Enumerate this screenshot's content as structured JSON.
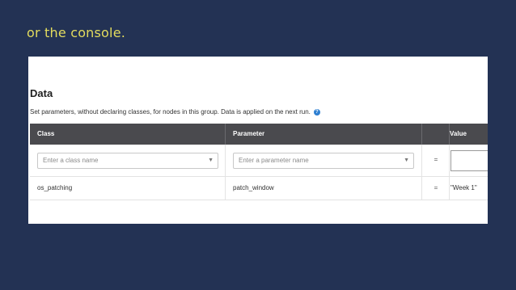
{
  "caption": "or the console.",
  "section": {
    "title": "Data",
    "description": "Set parameters, without declaring classes, for nodes in this group. Data is applied on the next run.",
    "help_icon": "?"
  },
  "table": {
    "headers": {
      "class": "Class",
      "parameter": "Parameter",
      "operator": "",
      "value": "Value"
    },
    "new_row": {
      "class_placeholder": "Enter a class name",
      "parameter_placeholder": "Enter a parameter name",
      "operator": "=",
      "value": ""
    },
    "rows": [
      {
        "class": "os_patching",
        "parameter": "patch_window",
        "operator": "=",
        "value": "\"Week 1\""
      }
    ]
  },
  "colors": {
    "background": "#233254",
    "caption": "#e3dc5e",
    "header": "#4a4a4e",
    "help_icon": "#2d7fd1"
  }
}
